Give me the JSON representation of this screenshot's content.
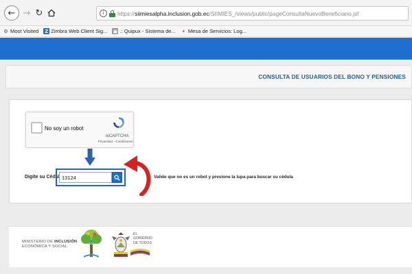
{
  "browser": {
    "url_protocol": "https://",
    "url_domain": "siimiesalpha.inclusion.gob.ec",
    "url_path": "/SIIMIES_/views/public/pageConsultaNuevoBeneficiario.jsf",
    "bookmarks": [
      {
        "label": "Most Visited",
        "icon": "gear-icon"
      },
      {
        "label": "Zimbra Web Client Sig...",
        "icon": "zimbra-icon"
      },
      {
        "label": ".: Quipux - Sistema de...",
        "icon": "quipux-icon"
      },
      {
        "label": "Mesa de Servicios: Log...",
        "icon": "mesa-icon"
      }
    ]
  },
  "page": {
    "title": "CONSULTA DE USUARIOS DEL BONO Y PENSIONES",
    "header_color": "#1f6fd1"
  },
  "captcha": {
    "label": "No soy un robot",
    "brand": "reCAPTCHA",
    "links": "Privacidad - Condiciones"
  },
  "form": {
    "id_label": "Digite su Cédula:",
    "id_value": "13124",
    "instruction": "Valide que no es un robot y presione la lupa para buscar su cédula",
    "arrow_color": "#d6231f",
    "highlight_color": "#2a62b8"
  },
  "footer": {
    "ministry_line1": "MINISTERIO DE ",
    "ministry_line1_bold": "INCLUSIÓN",
    "ministry_line2": "ECONÓMICA Y SOCIAL",
    "gob_line1": "EL",
    "gob_line2": "GOBIERNO",
    "gob_line3": "DE TODOS"
  }
}
